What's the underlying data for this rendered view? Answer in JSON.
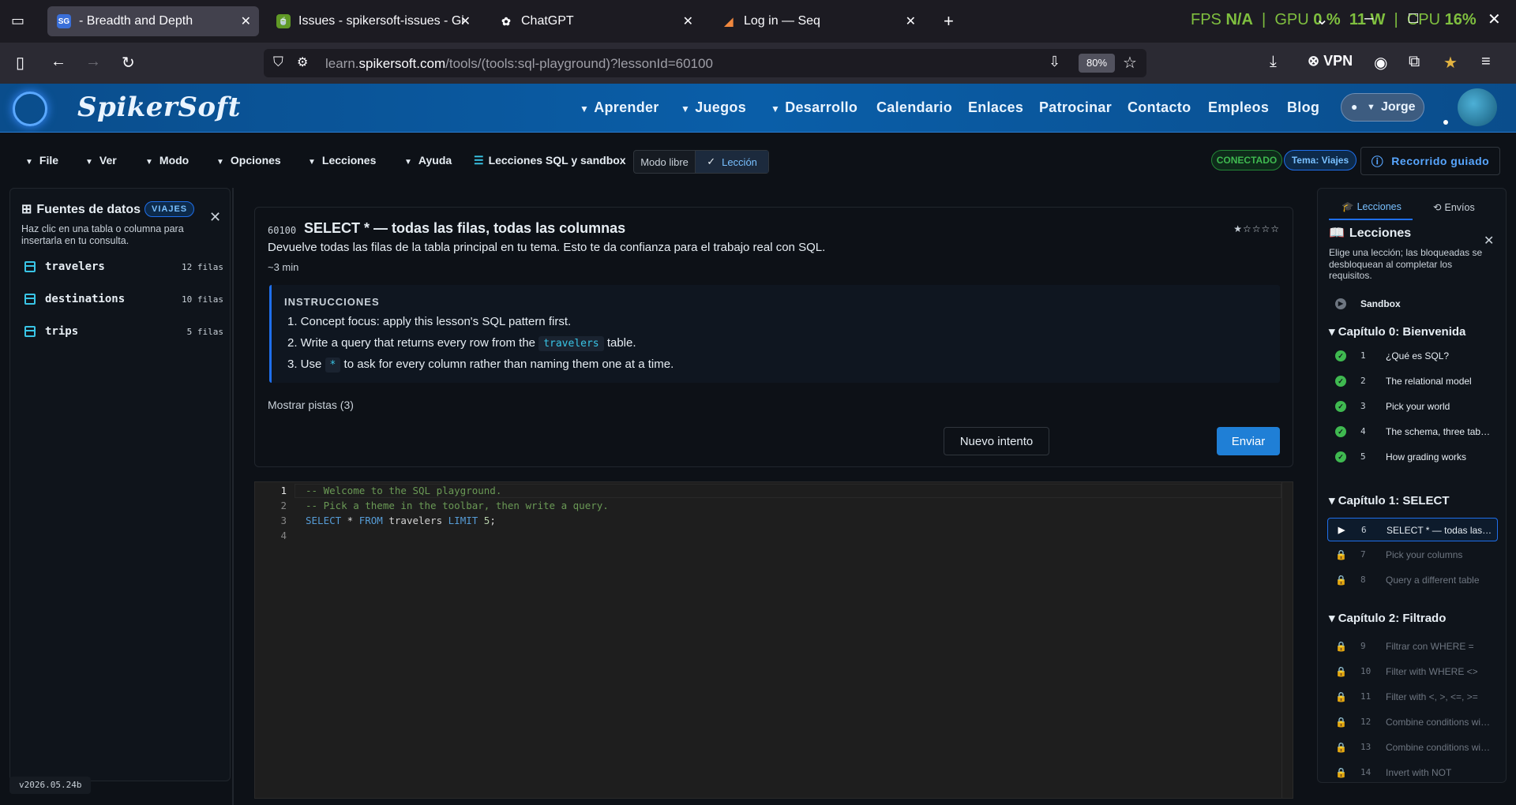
{
  "browser": {
    "tabs": [
      {
        "title": "- Breadth and Depth",
        "favicon": "SG",
        "active": true
      },
      {
        "title": "Issues - spikersoft-issues - Gitea",
        "favicon": "gitea-icon",
        "active": false
      },
      {
        "title": "ChatGPT",
        "favicon": "chatgpt-icon",
        "active": false
      },
      {
        "title": "Log in — Seq",
        "favicon": "seq-icon",
        "active": false
      }
    ],
    "overlay": {
      "fps_label": "FPS",
      "fps_value": "N/A",
      "gpu_label": "GPU",
      "gpu_value": "0 %",
      "gpu_power": "11 W",
      "cpu_label": "CPU",
      "cpu_value": "16%"
    },
    "url_prefix": "learn.",
    "url_domain": "spikersoft.com",
    "url_rest": "/tools/(tools:sql-playground)?lessonId=60100",
    "zoom": "80%",
    "vpn_label": "VPN"
  },
  "site": {
    "logo": "SpikerSoft",
    "nav": [
      {
        "label": "Aprender",
        "dropdown": true
      },
      {
        "label": "Juegos",
        "dropdown": true
      },
      {
        "label": "Desarrollo",
        "dropdown": true
      },
      {
        "label": "Calendario",
        "dropdown": false
      },
      {
        "label": "Enlaces",
        "dropdown": false
      },
      {
        "label": "Patrocinar",
        "dropdown": false
      },
      {
        "label": "Contacto",
        "dropdown": false
      },
      {
        "label": "Empleos",
        "dropdown": false
      },
      {
        "label": "Blog",
        "dropdown": false
      }
    ],
    "user": "Jorge"
  },
  "toolbar": {
    "menus": [
      "File",
      "Ver",
      "Modo",
      "Opciones",
      "Lecciones",
      "Ayuda"
    ],
    "lessons_title": "Lecciones SQL y sandbox",
    "mode_free": "Modo libre",
    "mode_lesson": "Lección",
    "status": "CONECTADO",
    "theme": "Tema: Viajes",
    "guided": "Recorrido guiado"
  },
  "datasources": {
    "title": "Fuentes de datos",
    "badge": "VIAJES",
    "description": "Haz clic en una tabla o columna para insertarla en tu consulta.",
    "tables": [
      {
        "name": "travelers",
        "rows": "12 filas"
      },
      {
        "name": "destinations",
        "rows": "10 filas"
      },
      {
        "name": "trips",
        "rows": "5 filas"
      }
    ]
  },
  "version": "v2026.05.24b",
  "lesson": {
    "id": "60100",
    "title": "SELECT * — todas las filas, todas las columnas",
    "stars": "★☆☆☆☆",
    "description": "Devuelve todas las filas de la tabla principal en tu tema. Esto te da confianza para el trabajo real con SQL.",
    "time": "~3 min",
    "instructions_label": "INSTRUCCIONES",
    "instr1": "1. Concept focus: apply this lesson's SQL pattern first.",
    "instr2_pre": "2. Write a query that returns every row from the",
    "instr2_code": "travelers",
    "instr2_post": "table.",
    "instr3_pre": "3. Use",
    "instr3_code": "*",
    "instr3_post": "to ask for every column rather than naming them one at a time.",
    "hints": "Mostrar pistas (3)",
    "retry": "Nuevo intento",
    "submit": "Enviar"
  },
  "editor": {
    "line_numbers": [
      "1",
      "2",
      "3",
      "4"
    ],
    "line1": "-- Welcome to the SQL playground.",
    "line2": "-- Pick a theme in the toolbar, then write a query.",
    "l3_kw1": "SELECT",
    "l3_star": " * ",
    "l3_kw2": "FROM",
    "l3_table": " travelers ",
    "l3_kw3": "LIMIT",
    "l3_num": " 5",
    "l3_end": ";"
  },
  "lessons_panel": {
    "tab_lessons": "Lecciones",
    "tab_submissions": "Envíos",
    "title": "Lecciones",
    "description": "Elige una lección; las bloqueadas se desbloquean al completar los requisitos.",
    "sandbox": "Sandbox",
    "chapters": [
      {
        "title": "Capítulo 0: Bienvenida"
      },
      {
        "title": "Capítulo 1: SELECT"
      },
      {
        "title": "Capítulo 2: Filtrado"
      }
    ],
    "items": [
      {
        "n": "1",
        "title": "¿Qué es SQL?",
        "state": "done"
      },
      {
        "n": "2",
        "title": "The relational model",
        "state": "done"
      },
      {
        "n": "3",
        "title": "Pick your world",
        "state": "done"
      },
      {
        "n": "4",
        "title": "The schema, three tables",
        "state": "done"
      },
      {
        "n": "5",
        "title": "How grading works",
        "state": "done"
      },
      {
        "n": "6",
        "title": "SELECT * — todas las filas",
        "state": "current"
      },
      {
        "n": "7",
        "title": "Pick your columns",
        "state": "locked"
      },
      {
        "n": "8",
        "title": "Query a different table",
        "state": "locked"
      },
      {
        "n": "9",
        "title": "Filtrar con WHERE =",
        "state": "locked"
      },
      {
        "n": "10",
        "title": "Filter with WHERE <>",
        "state": "locked"
      },
      {
        "n": "11",
        "title": "Filter with <, >, <=, >=",
        "state": "locked"
      },
      {
        "n": "12",
        "title": "Combine conditions with AND",
        "state": "locked"
      },
      {
        "n": "13",
        "title": "Combine conditions with OR",
        "state": "locked"
      },
      {
        "n": "14",
        "title": "Invert with NOT",
        "state": "locked"
      }
    ]
  }
}
